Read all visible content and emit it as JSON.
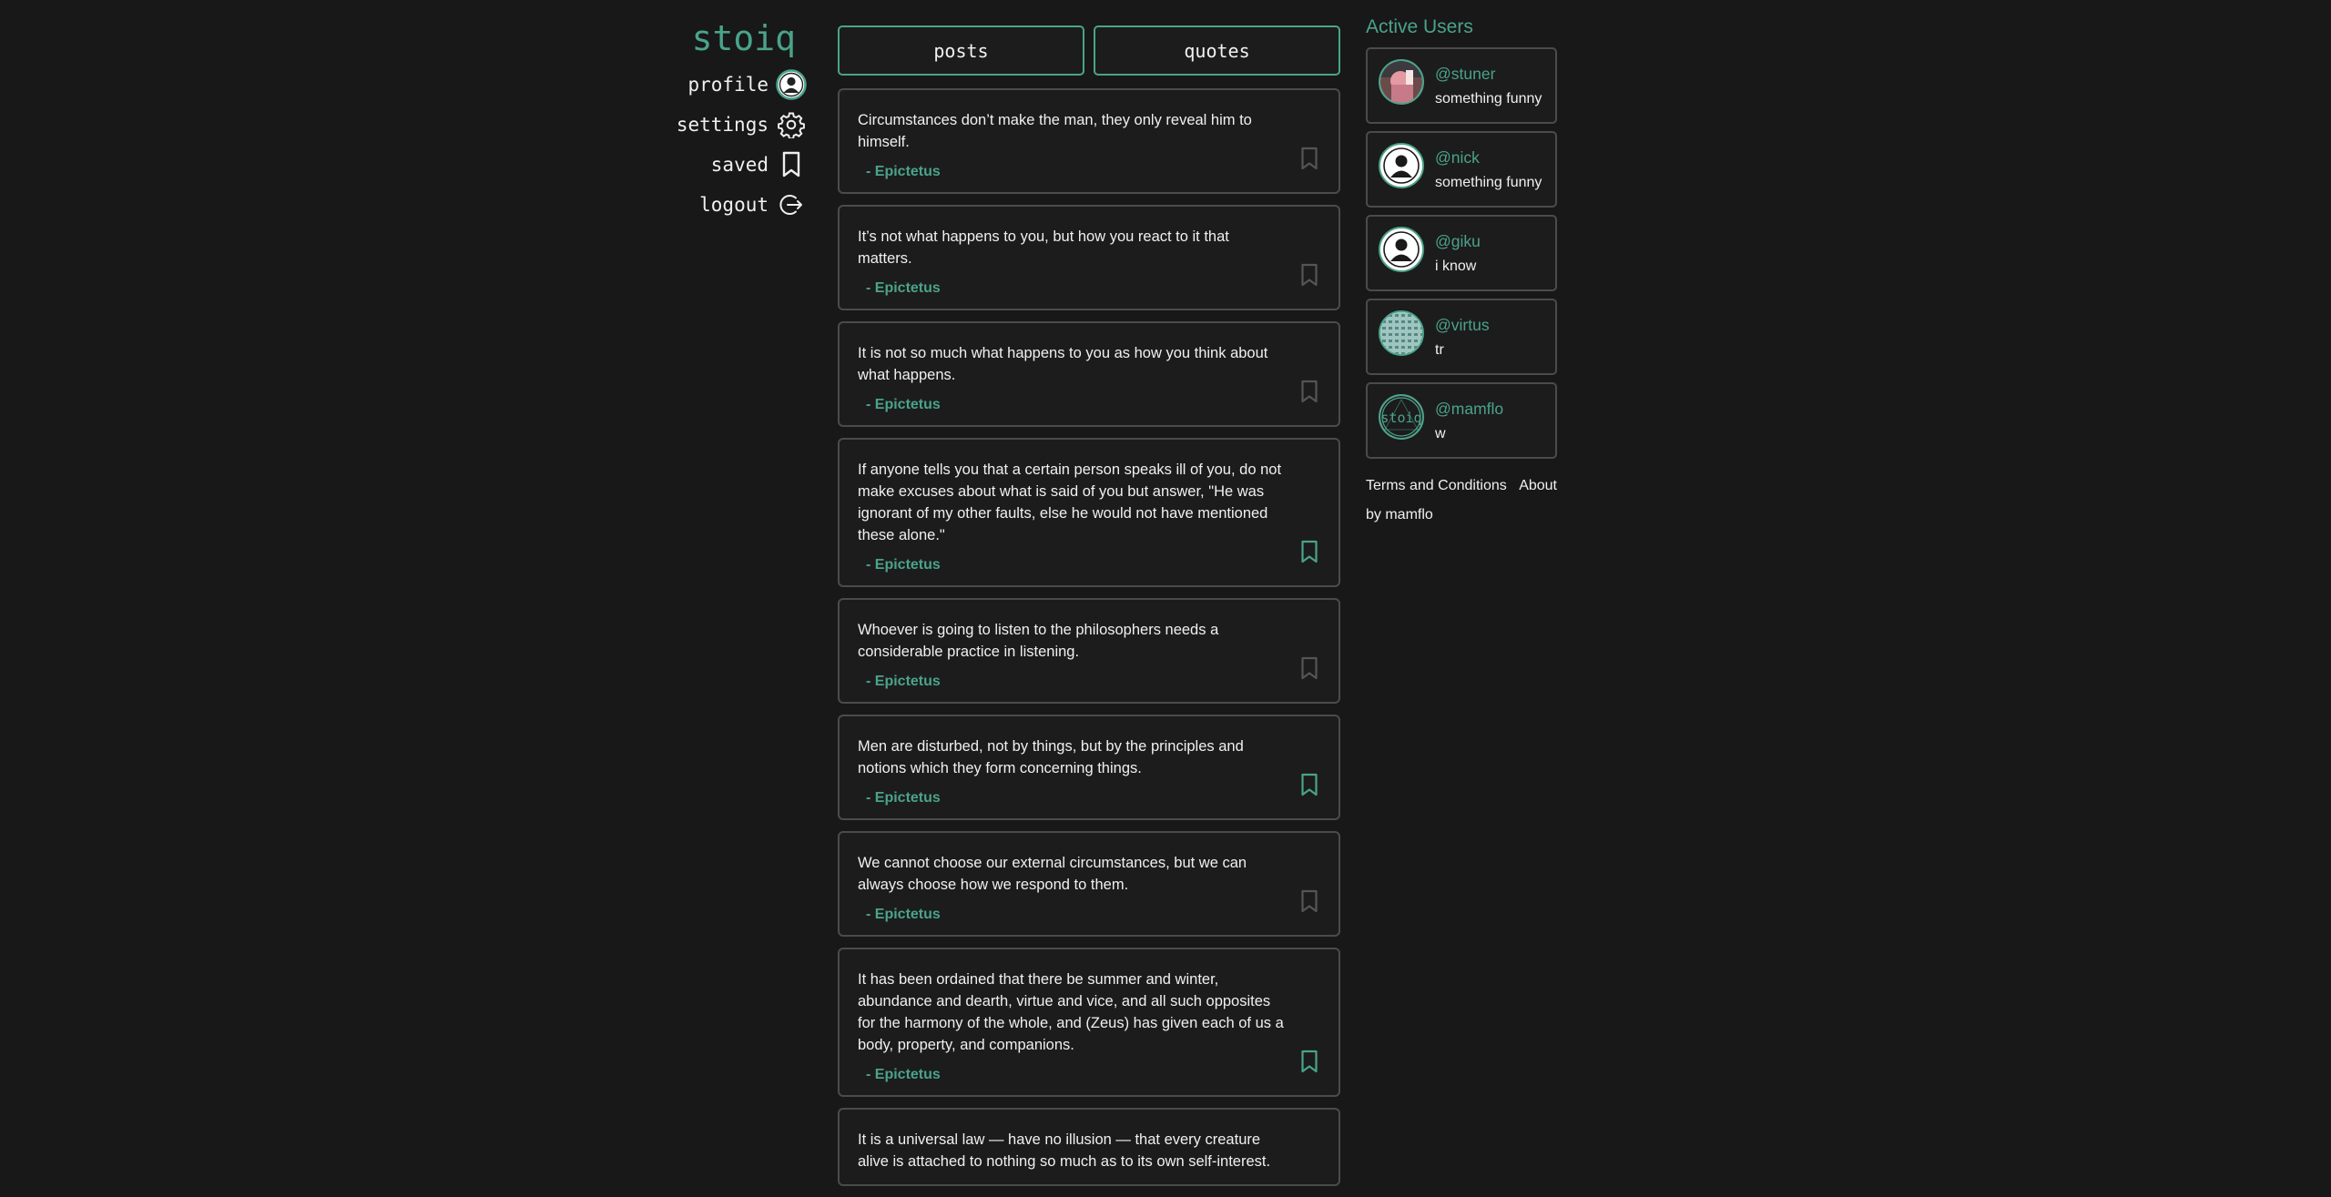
{
  "app": {
    "logo": "stoiq"
  },
  "nav": {
    "profile": "profile",
    "settings": "settings",
    "saved": "saved",
    "logout": "logout"
  },
  "tabs": {
    "posts": "posts",
    "quotes": "quotes"
  },
  "quotes": [
    {
      "text": "Circumstances don’t make the man, they only reveal him to himself.",
      "author": "- Epictetus",
      "saved": false
    },
    {
      "text": "It’s not what happens to you, but how you react to it that matters.",
      "author": "- Epictetus",
      "saved": false
    },
    {
      "text": "It is not so much what happens to you as how you think about what happens.",
      "author": "- Epictetus",
      "saved": false
    },
    {
      "text": "If anyone tells you that a certain person speaks ill of you, do not make excuses about what is said of you but answer, \"He was ignorant of my other faults, else he would not have mentioned these alone.\"",
      "author": "- Epictetus",
      "saved": true
    },
    {
      "text": "Whoever is going to listen to the philosophers needs a considerable practice in listening.",
      "author": "- Epictetus",
      "saved": false
    },
    {
      "text": "Men are disturbed, not by things, but by the principles and notions which they form concerning things.",
      "author": "- Epictetus",
      "saved": true
    },
    {
      "text": "We cannot choose our external circumstances, but we can always choose how we respond to them.",
      "author": "- Epictetus",
      "saved": false
    },
    {
      "text": "It has been ordained that there be summer and winter, abundance and dearth, virtue and vice, and all such opposites for the harmony of the whole, and (Zeus) has given each of us a body, property, and companions.",
      "author": "- Epictetus",
      "saved": true
    },
    {
      "text": "It is a universal law — have no illusion — that every creature alive is attached to nothing so much as to its own self-interest.",
      "author": "",
      "saved": false
    }
  ],
  "active_users": {
    "title": "Active Users",
    "users": [
      {
        "name": "@stuner",
        "status": "something funny",
        "avatar": "photo"
      },
      {
        "name": "@nick",
        "status": "something funny",
        "avatar": "default"
      },
      {
        "name": "@giku",
        "status": "i know",
        "avatar": "default"
      },
      {
        "name": "@virtus",
        "status": "tr",
        "avatar": "pattern"
      },
      {
        "name": "@mamflo",
        "status": "w",
        "avatar": "stoiq-logo"
      }
    ]
  },
  "avatar_text": {
    "stoiq": "stoiq"
  },
  "footer": {
    "terms": "Terms and Conditions",
    "about": "About",
    "by": "by mamflo"
  },
  "colors": {
    "accent": "#4aa38a",
    "background": "#181818",
    "card": "#1c1c1c",
    "border": "#4b4b4b",
    "bookmark_off": "#555555"
  }
}
